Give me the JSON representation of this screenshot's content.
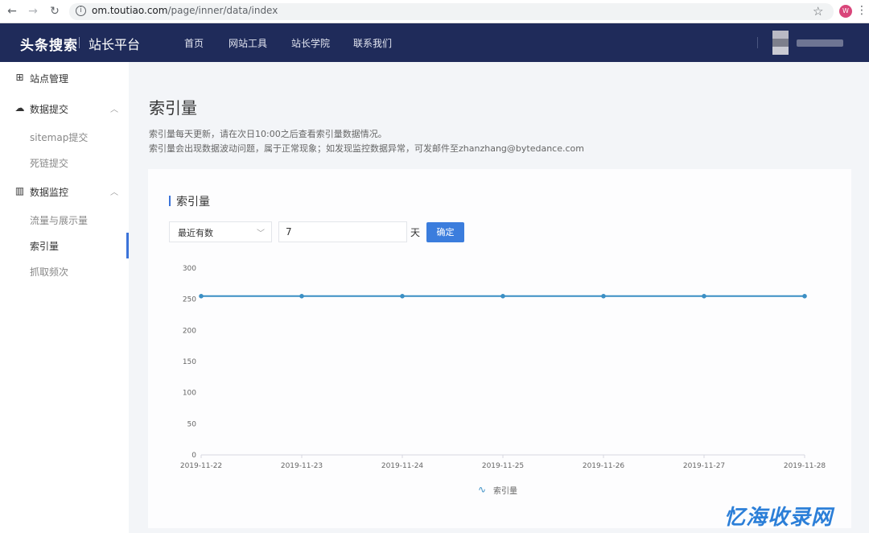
{
  "browser": {
    "url_host": "om.toutiao.com",
    "url_path": "/page/inner/data/index",
    "profile_initial": "W"
  },
  "topnav": {
    "brand": "头条搜索",
    "brand_sub": "站长平台",
    "items": [
      "首页",
      "网站工具",
      "站长学院",
      "联系我们"
    ]
  },
  "sidebar": {
    "site_manage": "站点管理",
    "data_submit": "数据提交",
    "submit_items": [
      "sitemap提交",
      "死链提交"
    ],
    "data_monitor": "数据监控",
    "monitor_items": [
      "流量与展示量",
      "索引量",
      "抓取频次"
    ],
    "active_item": "索引量"
  },
  "main": {
    "title": "索引量",
    "desc_line1": "索引量每天更新，请在次日10:00之后查看索引量数据情况。",
    "desc_line2": "索引量会出现数据波动问题，属于正常现象；如发现监控数据异常，可发邮件至zhanzhang@bytedance.com",
    "card_title": "索引量",
    "filter": {
      "select_value": "最近有数",
      "days_value": "7",
      "unit": "天",
      "confirm_label": "确定"
    }
  },
  "chart_data": {
    "type": "line",
    "x": [
      "2019-11-22",
      "2019-11-23",
      "2019-11-24",
      "2019-11-25",
      "2019-11-26",
      "2019-11-27",
      "2019-11-28"
    ],
    "series": [
      {
        "name": "索引量",
        "values": [
          255,
          255,
          255,
          255,
          255,
          255,
          255
        ]
      }
    ],
    "y_ticks": [
      0,
      50,
      100,
      150,
      200,
      250,
      300
    ],
    "ylim": [
      0,
      300
    ],
    "color": "#3b8fc4",
    "legend_position": "bottom"
  },
  "watermark": "忆海收录网"
}
